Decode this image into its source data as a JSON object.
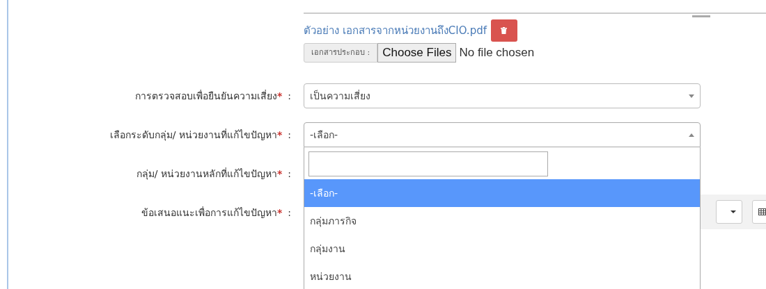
{
  "attachment": {
    "file_link": "ตัวอย่าง เอกสารจากหน่วยงานถึงCIO.pdf"
  },
  "file_input": {
    "label": "เอกสารประกอบ :",
    "button": "Choose Files",
    "status": "No file chosen"
  },
  "fields": [
    {
      "kind": "select",
      "label": "การตรวจสอบเพื่อยืนยันความเสี่ยง",
      "required_mark": "*",
      "separator": ":",
      "value": "เป็นความเสี่ยง",
      "open": false
    },
    {
      "kind": "select",
      "label": "เลือกระดับกลุ่ม/ หน่วยงานที่แก้ไขปัญหา",
      "required_mark": "*",
      "separator": ":",
      "value": "-เลือก-",
      "open": true,
      "options": [
        {
          "label": "-เลือก-",
          "selected": true
        },
        {
          "label": "กลุ่มภารกิจ",
          "selected": false
        },
        {
          "label": "กลุ่มงาน",
          "selected": false
        },
        {
          "label": "หน่วยงาน",
          "selected": false
        }
      ]
    },
    {
      "kind": "covered",
      "label": "กลุ่ม/ หน่วยงานหลักที่แก้ไขปัญหา",
      "required_mark": "*",
      "separator": ":"
    },
    {
      "kind": "editor",
      "label": "ข้อเสนอแนะเพื่อการแก้ไขปัญหา",
      "required_mark": "*",
      "separator": ":",
      "toolbar": [
        {
          "kind": "caret"
        },
        {
          "kind": "table"
        }
      ]
    }
  ]
}
